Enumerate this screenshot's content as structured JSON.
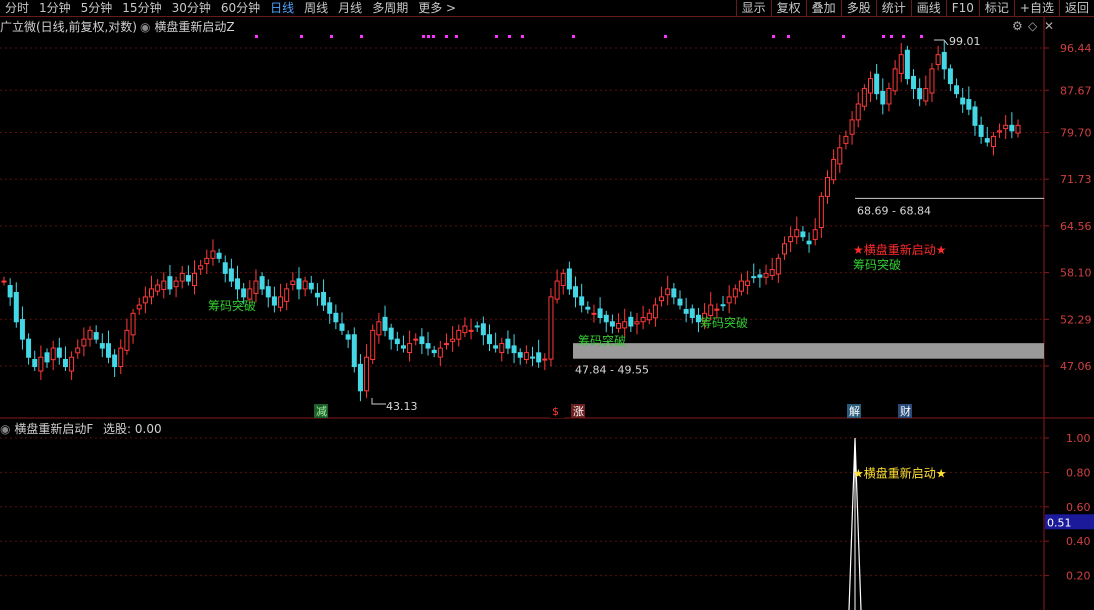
{
  "toolbar": {
    "periods": [
      {
        "label": "分时",
        "active": false
      },
      {
        "label": "1分钟",
        "active": false
      },
      {
        "label": "5分钟",
        "active": false
      },
      {
        "label": "15分钟",
        "active": false
      },
      {
        "label": "30分钟",
        "active": false
      },
      {
        "label": "60分钟",
        "active": false
      },
      {
        "label": "日线",
        "active": true
      },
      {
        "label": "周线",
        "active": false
      },
      {
        "label": "月线",
        "active": false
      },
      {
        "label": "多周期",
        "active": false
      },
      {
        "label": "更多 >",
        "active": false
      }
    ],
    "tools": [
      "显示",
      "复权",
      "叠加",
      "多股",
      "统计",
      "画线",
      "F10",
      "标记",
      "+自选",
      "返回"
    ]
  },
  "main_panel": {
    "stock": "广立微(日线,前复权,对数)",
    "indicator": "横盘重新启动Z",
    "y_ticks": [
      96.44,
      87.67,
      79.7,
      71.73,
      64.56,
      58.1,
      52.29,
      47.06
    ],
    "high_label": "99.01",
    "low_label": "43.13",
    "zones": [
      {
        "label": "68.69 - 68.84",
        "low": 68.69,
        "high": 68.84
      },
      {
        "label": "47.84 - 49.55",
        "low": 47.84,
        "high": 49.55
      }
    ],
    "annotations": [
      {
        "text": "筹码突破",
        "color": "#33cc33"
      },
      {
        "text": "筹码突破",
        "color": "#33cc33"
      },
      {
        "text": "筹码突破",
        "color": "#33cc33"
      },
      {
        "text": "★横盘重新启动★",
        "color": "#ff2a2a"
      },
      {
        "text": "筹码突破",
        "color": "#33cc33"
      }
    ],
    "event_badges": [
      {
        "text": "减",
        "bg": "#1f5e2a",
        "fg": "#9ef0a0"
      },
      {
        "text": "$",
        "bg": "#000000",
        "fg": "#ff3a3a"
      },
      {
        "text": "涨",
        "bg": "#6b1f1f",
        "fg": "#ffffff"
      },
      {
        "text": "解",
        "bg": "#2a5b7a",
        "fg": "#ffffff"
      },
      {
        "text": "财",
        "bg": "#2a4b7a",
        "fg": "#ffffff"
      }
    ]
  },
  "sub_panel": {
    "title": "横盘重新启动F",
    "select_label": "选股:",
    "select_value": "0.00",
    "y_ticks": [
      1.0,
      0.8,
      0.6,
      0.4,
      0.2
    ],
    "cursor_value": "0.51",
    "signal_label": "★横盘重新启动★",
    "signal_value": 1.0
  },
  "colors": {
    "up": "#ff3a3a",
    "down": "#44d7e6",
    "grid": "#5a1010",
    "axis": "#8b1a1a",
    "magenta": "#ff33ff"
  }
}
